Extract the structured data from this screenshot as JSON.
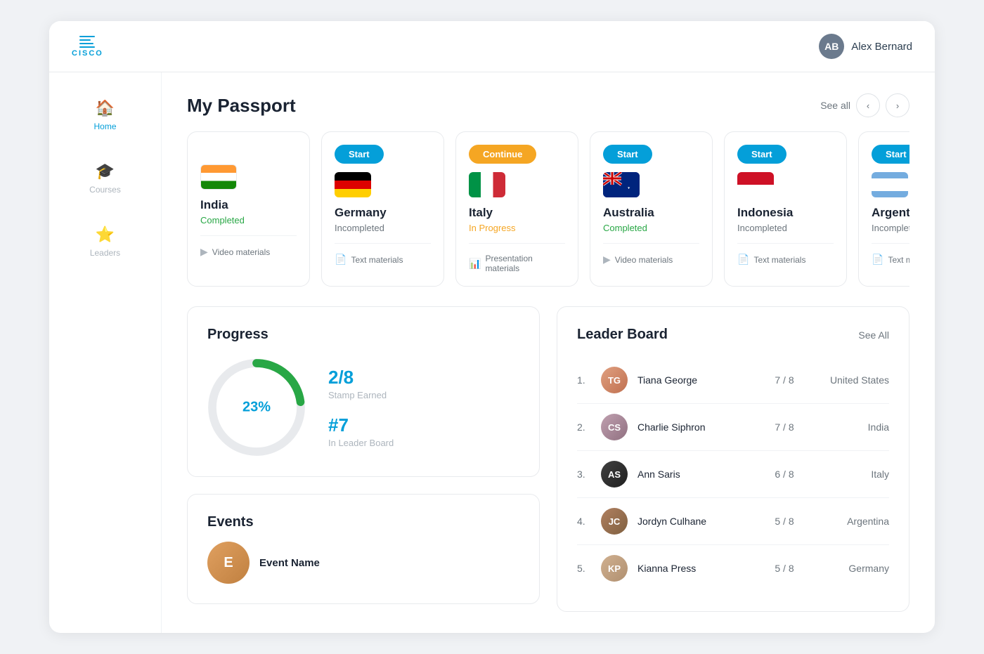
{
  "header": {
    "logo_text": "CISCO",
    "user_name": "Alex Bernard"
  },
  "sidebar": {
    "items": [
      {
        "id": "home",
        "label": "Home",
        "icon": "🏠",
        "active": true
      },
      {
        "id": "courses",
        "label": "Courses",
        "icon": "🎓",
        "active": false
      },
      {
        "id": "leaders",
        "label": "Leaders",
        "icon": "⭐",
        "active": false
      }
    ]
  },
  "passport": {
    "title": "My Passport",
    "see_all": "See all",
    "cards": [
      {
        "id": "india",
        "action": null,
        "country": "India",
        "status": "Completed",
        "status_type": "completed",
        "material": "Video materials",
        "material_icon": "▶"
      },
      {
        "id": "germany",
        "action": "Start",
        "action_type": "start",
        "country": "Germany",
        "status": "Incompleted",
        "status_type": "incompleted",
        "material": "Text materials",
        "material_icon": "📄"
      },
      {
        "id": "italy",
        "action": "Continue",
        "action_type": "continue",
        "country": "Italy",
        "status": "In Progress",
        "status_type": "inprogress",
        "material": "Presentation materials",
        "material_icon": "📊"
      },
      {
        "id": "australia",
        "action": "Start",
        "action_type": "start",
        "country": "Australia",
        "status": "Completed",
        "status_type": "completed",
        "material": "Video materials",
        "material_icon": "▶"
      },
      {
        "id": "indonesia",
        "action": "Start",
        "action_type": "start",
        "country": "Indonesia",
        "status": "Incompleted",
        "status_type": "incompleted",
        "material": "Text materials",
        "material_icon": "📄"
      },
      {
        "id": "argentina",
        "action": "Start",
        "action_type": "start",
        "country": "Argentin...",
        "status": "Incomplete...",
        "status_type": "incompleted",
        "material": "Text ma...",
        "material_icon": "📄"
      }
    ]
  },
  "progress": {
    "title": "Progress",
    "percentage": "23%",
    "stamp_value": "2/8",
    "stamp_label": "Stamp Earned",
    "rank_value": "#7",
    "rank_label": "In Leader Board"
  },
  "events": {
    "title": "Events",
    "event_name_label": "Event Name"
  },
  "leaderboard": {
    "title": "Leader Board",
    "see_all": "See All",
    "rows": [
      {
        "rank": "1.",
        "name": "Tiana George",
        "score": "7 / 8",
        "country": "United States",
        "avatar_class": "av-tiana",
        "initials": "TG"
      },
      {
        "rank": "2.",
        "name": "Charlie Siphron",
        "score": "7 / 8",
        "country": "India",
        "avatar_class": "av-charlie",
        "initials": "CS"
      },
      {
        "rank": "3.",
        "name": "Ann Saris",
        "score": "6 / 8",
        "country": "Italy",
        "avatar_class": "av-ann",
        "initials": "AS"
      },
      {
        "rank": "4.",
        "name": "Jordyn Culhane",
        "score": "5 / 8",
        "country": "Argentina",
        "avatar_class": "av-jordyn",
        "initials": "JC"
      },
      {
        "rank": "5.",
        "name": "Kianna Press",
        "score": "5 / 8",
        "country": "Germany",
        "avatar_class": "av-kianna",
        "initials": "KP"
      }
    ]
  }
}
